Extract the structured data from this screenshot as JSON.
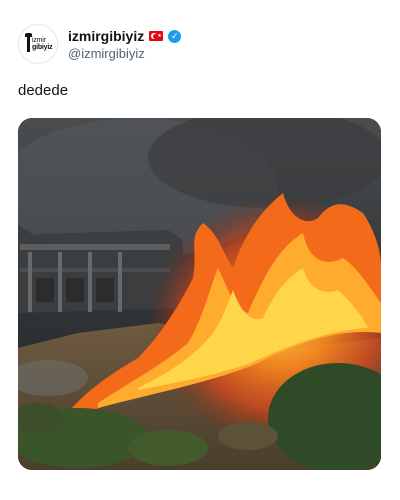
{
  "tweet": {
    "author": {
      "display_name": "izmirgibiyiz",
      "handle": "@izmirgibiyiz",
      "avatar_logo_line1": "izmir",
      "avatar_logo_line2": "gibiyiz",
      "flag_icon": "turkey-flag-icon",
      "verified_icon": "verified-badge-icon"
    },
    "text": "dedede",
    "media": {
      "type": "photo",
      "icon": "wildfire-photo"
    }
  },
  "colors": {
    "text": "#0f1419",
    "secondary_text": "#536471",
    "verified": "#1d9bf0",
    "flag_red": "#e30a17"
  }
}
